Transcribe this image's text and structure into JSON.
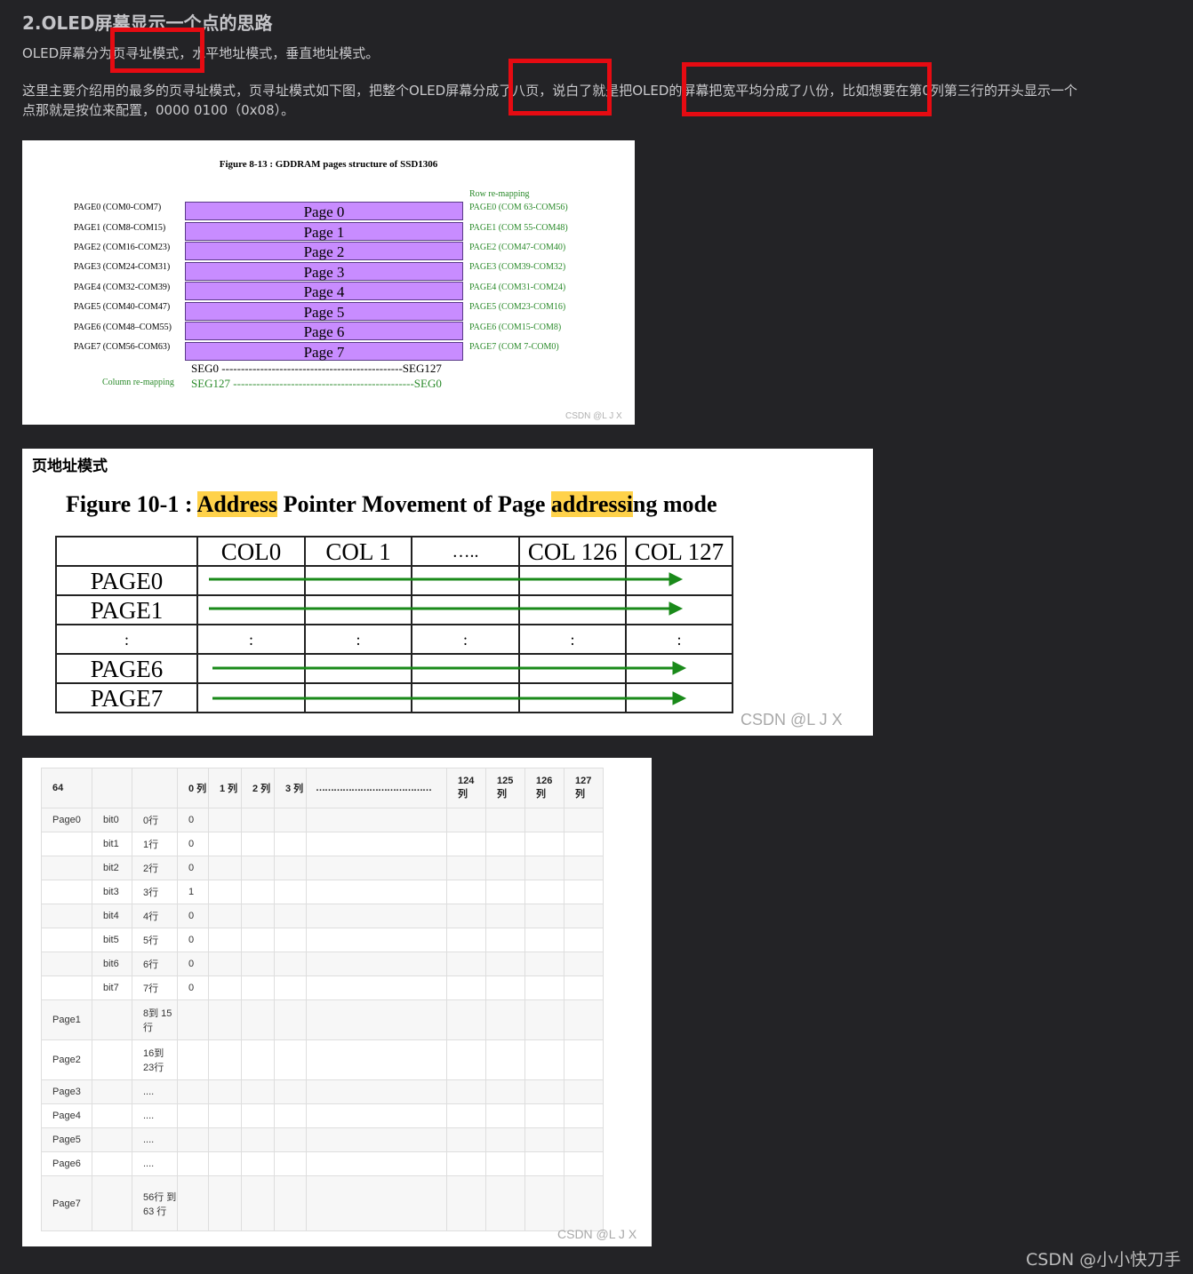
{
  "heading": "2.OLED屏幕显示一个点的思路",
  "para1": "OLED屏幕分为页寻址模式，水平地址模式，垂直地址模式。",
  "para2_line1": "这里主要介绍用的最多的页寻址模式，页寻址模式如下图，把整个OLED屏幕分成了八页，说白了就是把OLED的屏幕把宽平均分成了八份，比如想要在第0列第三行的开头显示一个",
  "para2_line2": "点那就是按位来配置，0000 0100（0x08）。",
  "fig1": {
    "title": "Figure 8-13 : GDDRAM pages structure of SSD1306",
    "row_remap_label": "Row re-mapping",
    "left_labels": [
      "PAGE0 (COM0-COM7)",
      "PAGE1 (COM8-COM15)",
      "PAGE2 (COM16-COM23)",
      "PAGE3 (COM24-COM31)",
      "PAGE4 (COM32-COM39)",
      "PAGE5 (COM40-COM47)",
      "PAGE6 (COM48–COM55)",
      "PAGE7 (COM56-COM63)"
    ],
    "pages": [
      "Page 0",
      "Page 1",
      "Page 2",
      "Page 3",
      "Page 4",
      "Page 5",
      "Page 6",
      "Page 7"
    ],
    "right_labels": [
      "PAGE0 (COM 63-COM56)",
      "PAGE1 (COM 55-COM48)",
      "PAGE2 (COM47-COM40)",
      "PAGE3 (COM39-COM32)",
      "PAGE4 (COM31-COM24)",
      "PAGE5 (COM23-COM16)",
      "PAGE6 (COM15-COM8)",
      "PAGE7 (COM 7-COM0)"
    ],
    "seg_line": "SEG0 -----------------------------------------------SEG127",
    "seg_remap_line": "SEG127 -----------------------------------------------SEG0",
    "col_remap_label": "Column re-mapping",
    "watermark": "CSDN @L  J  X"
  },
  "fig2": {
    "caption": "页地址模式",
    "title_prefix": "Figure 10-1 : ",
    "title_hl1": "Address",
    "title_mid": " Pointer Movement of Page ",
    "title_hl2": "addressi",
    "title_suffix": "ng mode",
    "headers": [
      "",
      "COL0",
      "COL 1",
      "…..",
      "COL 126",
      "COL 127"
    ],
    "rows": [
      "PAGE0",
      "PAGE1",
      ":",
      "PAGE6",
      "PAGE7"
    ],
    "colon": ":",
    "watermark": "CSDN @L  J  X",
    "arrow_color": "#1a8a1a"
  },
  "fig3": {
    "header": [
      "64",
      "",
      "",
      "0 列",
      "1 列",
      "2 列",
      "3 列",
      "…………………………………",
      "124 列",
      "125 列",
      "126 列",
      "127 列"
    ],
    "rows": [
      [
        "Page0",
        "bit0",
        "0行",
        "0"
      ],
      [
        "",
        "bit1",
        "1行",
        "0"
      ],
      [
        "",
        "bit2",
        "2行",
        "0"
      ],
      [
        "",
        "bit3",
        "3行",
        "1"
      ],
      [
        "",
        "bit4",
        "4行",
        "0"
      ],
      [
        "",
        "bit5",
        "5行",
        "0"
      ],
      [
        "",
        "bit6",
        "6行",
        "0"
      ],
      [
        "",
        "bit7",
        "7行",
        "0"
      ],
      [
        "Page1",
        "",
        "8到 15行",
        ""
      ],
      [
        "Page2",
        "",
        "16到 23行",
        ""
      ],
      [
        "Page3",
        "",
        "....",
        ""
      ],
      [
        "Page4",
        "",
        "....",
        ""
      ],
      [
        "Page5",
        "",
        "....",
        ""
      ],
      [
        "Page6",
        "",
        "....",
        ""
      ],
      [
        "Page7",
        "",
        "56行 到63 行",
        ""
      ]
    ],
    "watermark": "CSDN @L  J  X"
  },
  "footer": "CSDN @小小快刀手",
  "highlight_color": "#e60b12"
}
